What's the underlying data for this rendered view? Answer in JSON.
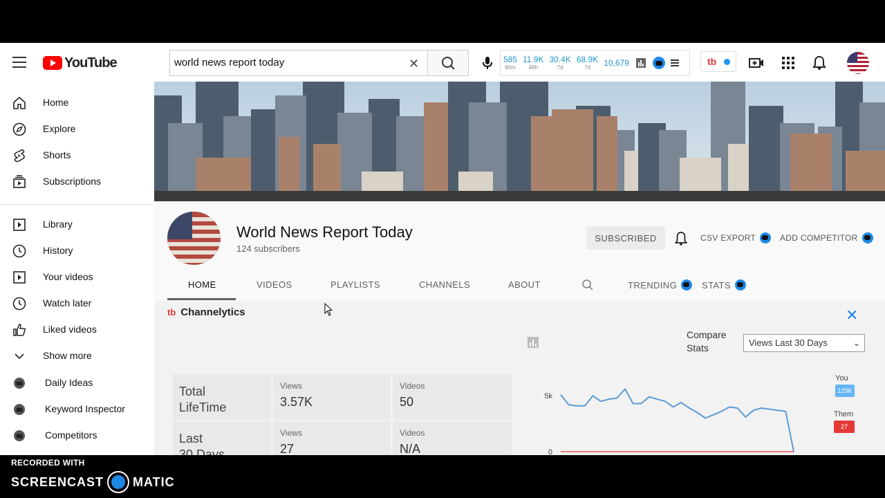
{
  "header": {
    "logo_text": "YouTube",
    "search_value": "world news report today",
    "stats": [
      {
        "value": "585",
        "label": "60m"
      },
      {
        "value": "11.9K",
        "label": "48h"
      },
      {
        "value": "30.4K",
        "label": "7d"
      },
      {
        "value": "68.9K",
        "label": "7d"
      },
      {
        "value": "10,679",
        "label": ""
      }
    ]
  },
  "sidebar": {
    "items": [
      {
        "label": "Home"
      },
      {
        "label": "Explore"
      },
      {
        "label": "Shorts"
      },
      {
        "label": "Subscriptions"
      },
      {
        "label": "Library"
      },
      {
        "label": "History"
      },
      {
        "label": "Your videos"
      },
      {
        "label": "Watch later"
      },
      {
        "label": "Liked videos"
      },
      {
        "label": "Show more"
      },
      {
        "label": "Daily Ideas"
      },
      {
        "label": "Keyword Inspector"
      },
      {
        "label": "Competitors"
      }
    ]
  },
  "channel": {
    "name": "World News Report Today",
    "subscribers": "124 subscribers",
    "subscribed_label": "SUBSCRIBED",
    "csv_export": "CSV EXPORT",
    "add_competitor": "ADD COMPETITOR",
    "tabs": [
      "HOME",
      "VIDEOS",
      "PLAYLISTS",
      "CHANNELS",
      "ABOUT",
      "TRENDING",
      "STATS"
    ]
  },
  "panel": {
    "brand_mark": "tb",
    "brand_title": "Channelytics",
    "compare_label": "Compare Stats",
    "compare_value": "Views Last 30 Days",
    "rows": [
      {
        "title_1": "Total",
        "title_2": "LifeTime",
        "views_label": "Views",
        "views": "3.57K",
        "videos_label": "Videos",
        "videos": "50"
      },
      {
        "title_1": "Last",
        "title_2": "30 Days",
        "views_label": "Views",
        "views": "27",
        "videos_label": "Videos",
        "videos": "N/A"
      }
    ],
    "legend_you": "You",
    "legend_you_value": "129K",
    "legend_them": "Them",
    "legend_them_value": "27"
  },
  "chart_data": {
    "type": "line",
    "title": "",
    "xlabel": "",
    "ylabel": "",
    "y_ticks": [
      "5k",
      "0"
    ],
    "ylim": [
      0,
      6500
    ],
    "series": [
      {
        "name": "You",
        "color": "#5b9bd5",
        "values": [
          5100,
          4200,
          4100,
          4100,
          5000,
          4500,
          4700,
          4800,
          5600,
          4300,
          4300,
          4900,
          4700,
          4500,
          4000,
          4400,
          3900,
          3500,
          3000,
          3300,
          3600,
          4000,
          3900,
          3100,
          3700,
          3900,
          3800,
          3700,
          3600,
          0
        ]
      },
      {
        "name": "Them",
        "color": "#e53935",
        "values": [
          0,
          0,
          0,
          0,
          0,
          0,
          0,
          0,
          0,
          0,
          0,
          0,
          0,
          0,
          0,
          0,
          0,
          0,
          0,
          0,
          0,
          0,
          0,
          0,
          0,
          0,
          0,
          0,
          0,
          0
        ]
      }
    ]
  },
  "watermark": {
    "recorded": "RECORDED WITH",
    "brand_left": "SCREENCAST",
    "brand_right": "MATIC"
  },
  "colors": {
    "accent": "#1e88e5",
    "brand_red": "#e53935"
  }
}
